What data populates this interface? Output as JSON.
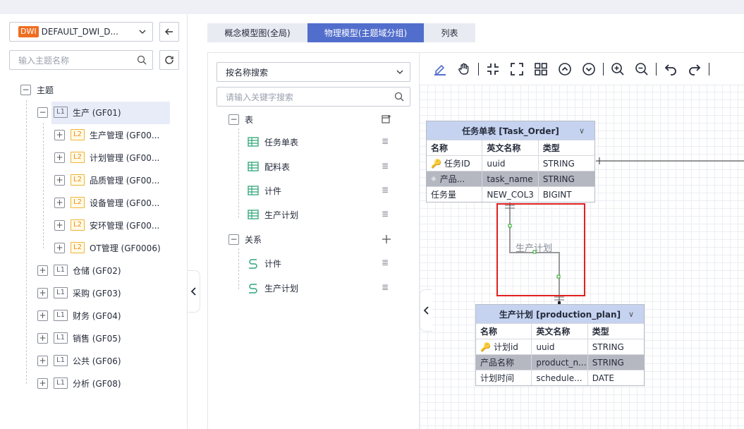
{
  "workspace": {
    "tag": "DWI",
    "name": "DEFAULT_DWI_D..."
  },
  "left_search": {
    "placeholder": "输入主题名称"
  },
  "tree": {
    "root": "主题",
    "groups": [
      {
        "level": "L1",
        "label": "生产 (GF01)",
        "expanded": true,
        "children": [
          {
            "level": "L2",
            "label": "生产管理 (GF00..."
          },
          {
            "level": "L2",
            "label": "计划管理 (GF00..."
          },
          {
            "level": "L2",
            "label": "品质管理 (GF00..."
          },
          {
            "level": "L2",
            "label": "设备管理 (GF00..."
          },
          {
            "level": "L2",
            "label": "安环管理 (GF00..."
          },
          {
            "level": "L2",
            "label": "OT管理 (GF0006)"
          }
        ]
      },
      {
        "level": "L1",
        "label": "仓储 (GF02)"
      },
      {
        "level": "L1",
        "label": "采购 (GF03)"
      },
      {
        "level": "L1",
        "label": "财务 (GF04)"
      },
      {
        "level": "L1",
        "label": "销售 (GF05)"
      },
      {
        "level": "L1",
        "label": "公共 (GF06)"
      },
      {
        "level": "L1",
        "label": "分析 (GF08)"
      }
    ]
  },
  "tabs": [
    {
      "label": "概念模型图(全局)",
      "active": false
    },
    {
      "label": "物理模型(主题域分组)",
      "active": true
    },
    {
      "label": "列表",
      "active": false
    }
  ],
  "mid": {
    "search_mode": "按名称搜索",
    "keyword_placeholder": "请输入关键字搜索",
    "tables_label": "表",
    "tables": [
      "任务单表",
      "配料表",
      "计件",
      "生产计划"
    ],
    "relations_label": "关系",
    "relations": [
      "计件",
      "生产计划"
    ]
  },
  "toolbar_icons": [
    "brush-icon",
    "hand-icon",
    "shrink-icon",
    "fullscreen-icon",
    "grid-icon",
    "circle-up-icon",
    "circle-down-icon",
    "zoom-in-icon",
    "zoom-out-icon",
    "undo-icon",
    "redo-icon"
  ],
  "entities": [
    {
      "title": "任务单表 [Task_Order]",
      "headers": [
        "名称",
        "英文名称",
        "类型"
      ],
      "rows": [
        {
          "name": "任务ID",
          "en": "uuid",
          "type": "STRING",
          "key": true,
          "hl": false
        },
        {
          "name": "产品...",
          "en": "task_name",
          "type": "STRING",
          "key": false,
          "hl": true
        },
        {
          "name": "任务量",
          "en": "NEW_COL3",
          "type": "BIGINT",
          "key": false,
          "hl": false
        }
      ]
    },
    {
      "title": "生产计划 [production_plan]",
      "headers": [
        "名称",
        "英文名称",
        "类型"
      ],
      "rows": [
        {
          "name": "计划id",
          "en": "uuid",
          "type": "STRING",
          "key": true,
          "hl": false
        },
        {
          "name": "产品名称",
          "en": "product_n...",
          "type": "STRING",
          "key": false,
          "hl": true
        },
        {
          "name": "计划时间",
          "en": "schedule...",
          "type": "DATE",
          "key": false,
          "hl": false
        }
      ]
    }
  ],
  "relation_label": "生产计划",
  "colors": {
    "accent": "#526ecc",
    "highlight_box": "#e02020",
    "entity_header": "#c5d3f0",
    "tag": "#ef6d21"
  }
}
